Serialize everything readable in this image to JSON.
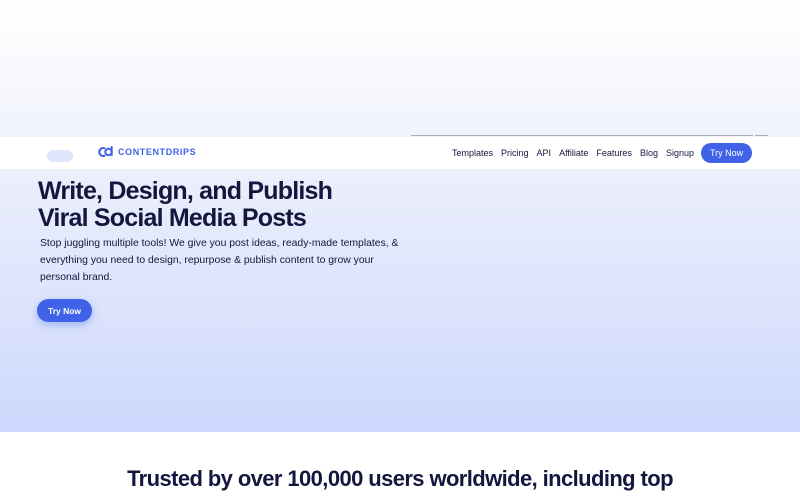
{
  "brand": {
    "name": "CONTENTDRIPS"
  },
  "nav": {
    "links": [
      "Templates",
      "Pricing",
      "API",
      "Affiliate",
      "Features",
      "Blog",
      "Signup"
    ],
    "cta_label": "Try Now"
  },
  "hero": {
    "title_line1": "Write, Design, and Publish",
    "title_line2": "Viral Social Media Posts",
    "subtitle": "Stop juggling multiple tools! We give you post ideas, ready-made templates, & everything you need to design, repurpose & publish content to grow your personal brand.",
    "cta_label": "Try Now"
  },
  "trusted": {
    "heading": "Trusted by over 100,000 users worldwide, including top"
  },
  "colors": {
    "accent": "#3f62e8",
    "text_dark": "#14163d"
  }
}
